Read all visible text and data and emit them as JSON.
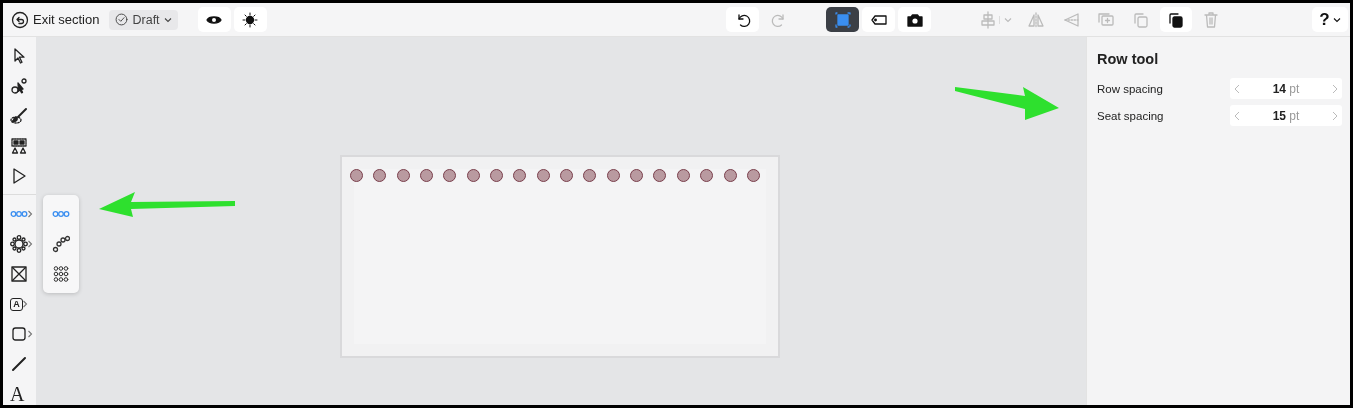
{
  "header": {
    "exit_label": "Exit section",
    "status": "Draft"
  },
  "view_buttons": [
    {
      "kind": "eye"
    },
    {
      "kind": "sun"
    }
  ],
  "history": [
    {
      "kind": "undo",
      "disabled": false
    },
    {
      "kind": "redo",
      "disabled": true
    }
  ],
  "modes": [
    {
      "kind": "select-seats",
      "selected": true
    },
    {
      "kind": "label",
      "selected": false
    },
    {
      "kind": "camera",
      "selected": false
    }
  ],
  "actions": [
    {
      "kind": "align",
      "disabled": true
    },
    {
      "kind": "flip-h",
      "disabled": true
    },
    {
      "kind": "flip-v",
      "disabled": true
    },
    {
      "kind": "copy-add",
      "disabled": true
    },
    {
      "kind": "duplicate",
      "disabled": true
    },
    {
      "kind": "paste",
      "disabled": false
    },
    {
      "kind": "trash",
      "disabled": true
    }
  ],
  "help": {
    "label": "?"
  },
  "tools": [
    {
      "kind": "pointer",
      "selected": false,
      "submenu": false
    },
    {
      "kind": "node-select",
      "selected": false,
      "submenu": false
    },
    {
      "kind": "brush",
      "selected": false,
      "submenu": false
    },
    {
      "kind": "table-seats",
      "selected": false,
      "submenu": false
    },
    {
      "kind": "vertex",
      "selected": false,
      "submenu": false
    },
    {
      "kind": "row",
      "selected": true,
      "submenu": true
    },
    {
      "kind": "round-table",
      "selected": false,
      "submenu": true
    },
    {
      "kind": "booth",
      "selected": false,
      "submenu": false
    },
    {
      "kind": "text-area",
      "selected": false,
      "submenu": true,
      "glyph": "A"
    },
    {
      "kind": "shape",
      "selected": false,
      "submenu": true
    },
    {
      "kind": "line",
      "selected": false,
      "submenu": false
    },
    {
      "kind": "text",
      "selected": false,
      "submenu": false,
      "glyph": "A"
    }
  ],
  "flyout": [
    {
      "kind": "row",
      "selected": true
    },
    {
      "kind": "curve",
      "selected": false
    },
    {
      "kind": "grid",
      "selected": false
    }
  ],
  "seats": [
    {
      "kind": "seat"
    },
    {
      "kind": "seat"
    },
    {
      "kind": "seat"
    },
    {
      "kind": "seat"
    },
    {
      "kind": "seat"
    },
    {
      "kind": "seat"
    },
    {
      "kind": "seat"
    },
    {
      "kind": "seat"
    },
    {
      "kind": "seat"
    },
    {
      "kind": "seat"
    },
    {
      "kind": "seat"
    },
    {
      "kind": "seat"
    },
    {
      "kind": "seat"
    },
    {
      "kind": "seat"
    },
    {
      "kind": "seat"
    },
    {
      "kind": "seat"
    },
    {
      "kind": "seat"
    },
    {
      "kind": "seat"
    }
  ],
  "panel": {
    "title": "Row tool",
    "fields": [
      {
        "label": "Row spacing",
        "value": "14",
        "unit": "pt"
      },
      {
        "label": "Seat spacing",
        "value": "15",
        "unit": "pt"
      }
    ]
  }
}
